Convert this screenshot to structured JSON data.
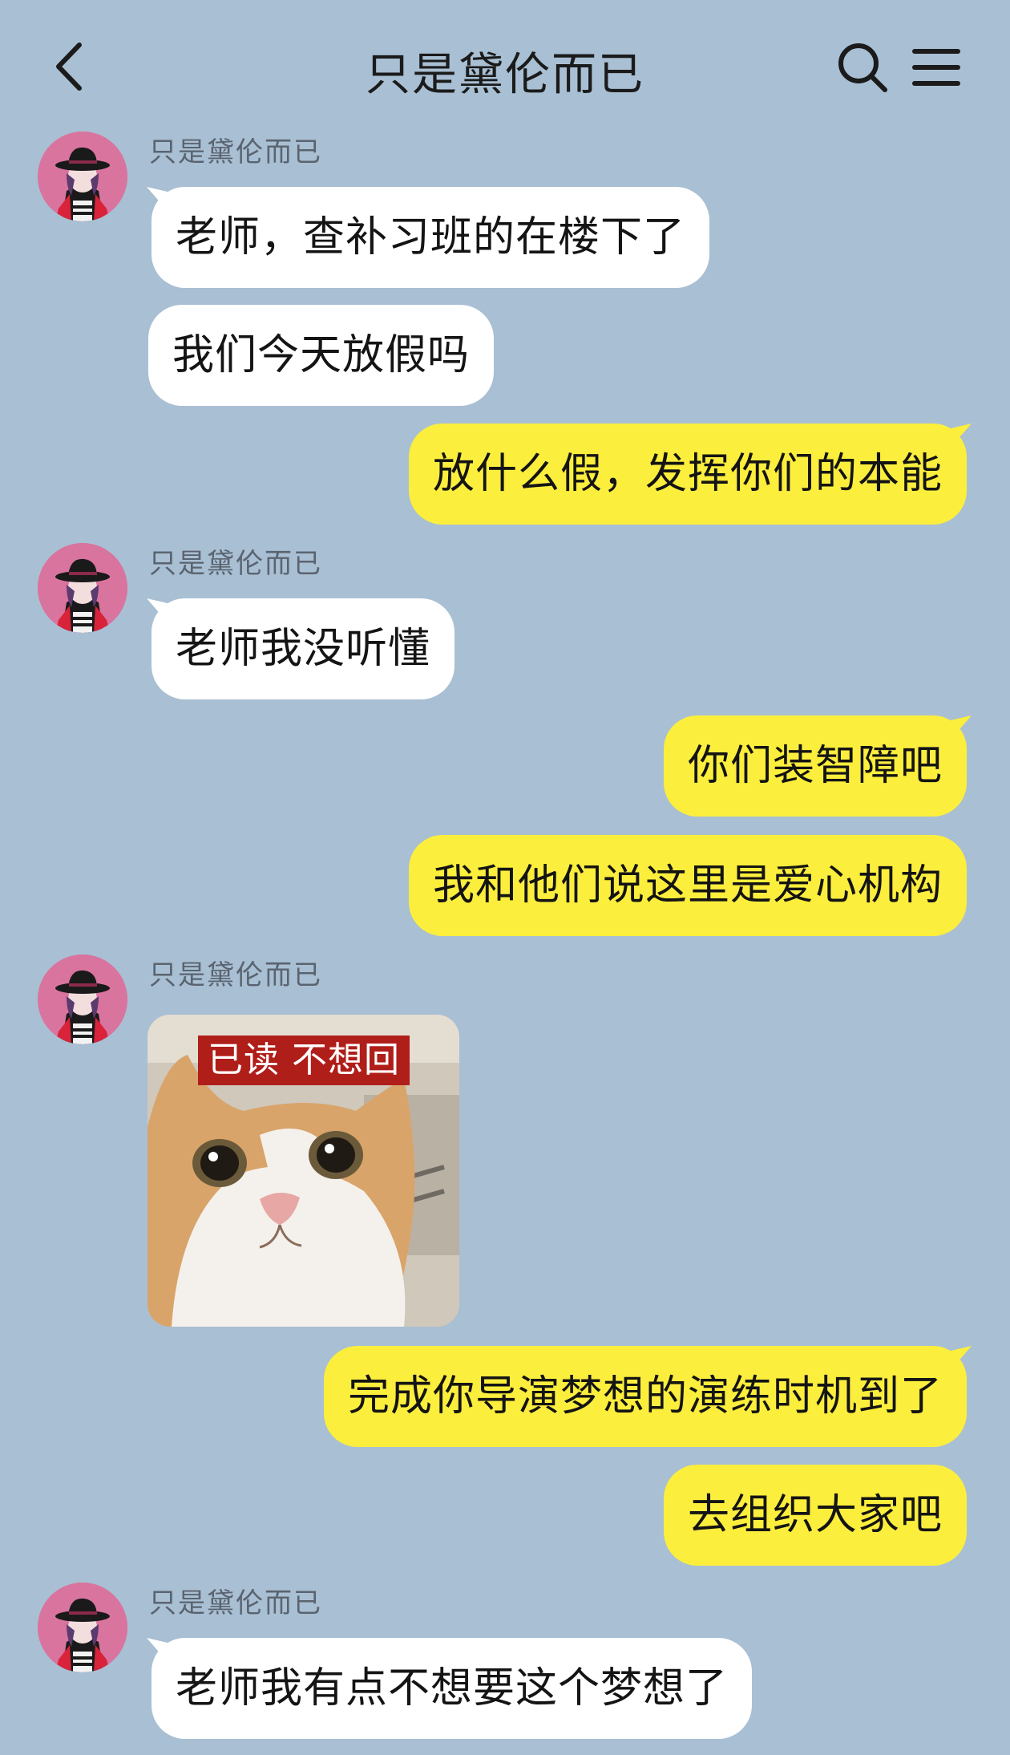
{
  "header": {
    "title": "只是黛伦而已",
    "back_icon": "chevron-left-icon",
    "search_icon": "search-icon",
    "menu_icon": "hamburger-menu-icon"
  },
  "colors": {
    "background": "#a9bfd3",
    "incoming_bubble": "#ffffff",
    "outgoing_bubble": "#fcee3d",
    "sticker_label_bg": "#b01e1a"
  },
  "messages": [
    {
      "sender": "只是黛伦而已",
      "side": "left",
      "text": "老师，查补习班的在楼下了"
    },
    {
      "side": "left",
      "text": "我们今天放假吗"
    },
    {
      "side": "right",
      "text": "放什么假，发挥你们的本能"
    },
    {
      "sender": "只是黛伦而已",
      "side": "left",
      "text": "老师我没听懂"
    },
    {
      "side": "right",
      "text": "你们装智障吧"
    },
    {
      "side": "right",
      "text": "我和他们说这里是爱心机构"
    },
    {
      "sender": "只是黛伦而已",
      "side": "left",
      "type": "sticker",
      "sticker_text": "已读 不想回"
    },
    {
      "side": "right",
      "text": "完成你导演梦想的演练时机到了"
    },
    {
      "side": "right",
      "text": "去组织大家吧"
    },
    {
      "sender": "只是黛伦而已",
      "side": "left",
      "text": "老师我有点不想要这个梦想了"
    }
  ]
}
